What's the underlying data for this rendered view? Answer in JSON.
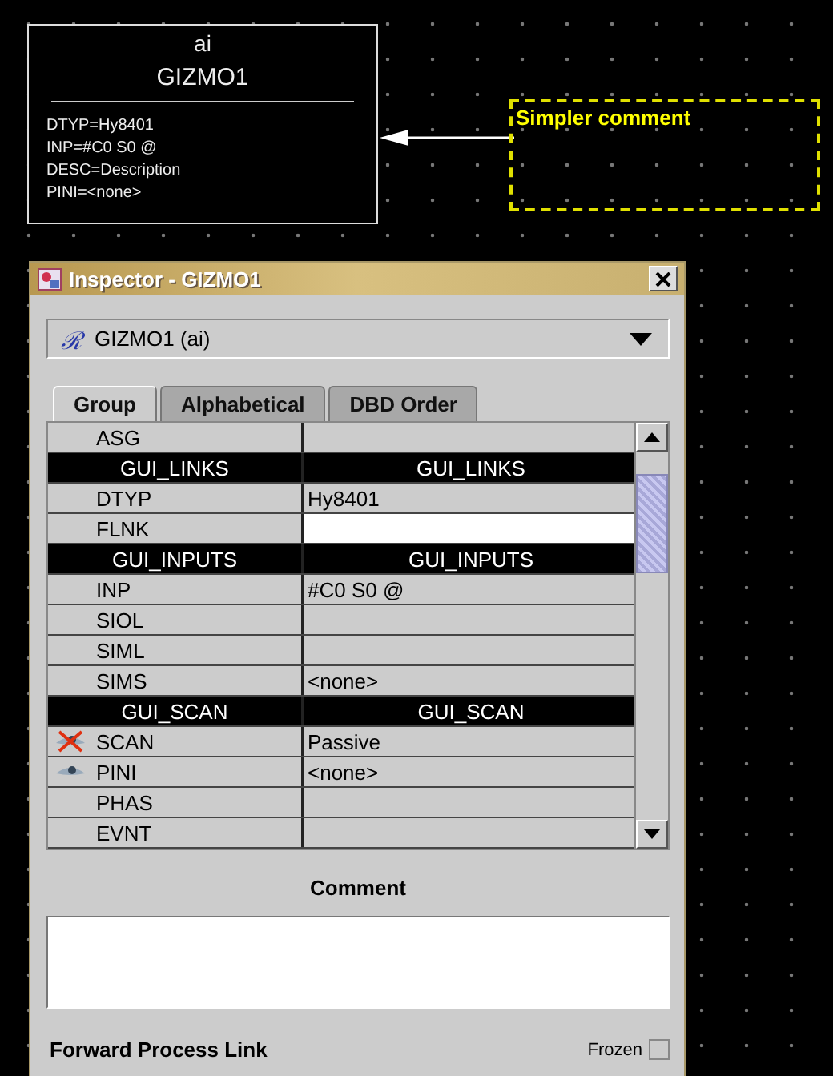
{
  "record": {
    "type": "ai",
    "name": "GIZMO1",
    "fields": [
      "DTYP=Hy8401",
      "INP=#C0 S0 @",
      "DESC=Description",
      "PINI=<none>"
    ]
  },
  "comment_node": {
    "text": "Simpler comment"
  },
  "inspector": {
    "title": "Inspector - GIZMO1",
    "record_select": {
      "icon": "ℛ",
      "value": "GIZMO1 (ai)"
    },
    "tabs": [
      {
        "label": "Group",
        "selected": true
      },
      {
        "label": "Alphabetical",
        "selected": false
      },
      {
        "label": "DBD Order",
        "selected": false
      }
    ],
    "rows": [
      {
        "kind": "field",
        "name": "ASG",
        "selected": false,
        "eye": false,
        "crossed": false
      },
      {
        "kind": "group",
        "name": "GUI_LINKS",
        "value": "GUI_LINKS"
      },
      {
        "kind": "field",
        "name": "DTYP",
        "value": "Hy8401",
        "selected": false,
        "eye": false,
        "crossed": false
      },
      {
        "kind": "field",
        "name": "FLNK",
        "selected": true,
        "eye": false,
        "crossed": false
      },
      {
        "kind": "group",
        "name": "GUI_INPUTS",
        "value": "GUI_INPUTS"
      },
      {
        "kind": "field",
        "name": "INP",
        "value": "#C0 S0 @",
        "selected": false,
        "eye": false,
        "crossed": false
      },
      {
        "kind": "field",
        "name": "SIOL",
        "selected": false,
        "eye": false,
        "crossed": false
      },
      {
        "kind": "field",
        "name": "SIML",
        "selected": false,
        "eye": false,
        "crossed": false
      },
      {
        "kind": "field",
        "name": "SIMS",
        "value": "<none>",
        "selected": false,
        "eye": false,
        "crossed": false
      },
      {
        "kind": "group",
        "name": "GUI_SCAN",
        "value": "GUI_SCAN"
      },
      {
        "kind": "field",
        "name": "SCAN",
        "value": "Passive",
        "selected": false,
        "eye": true,
        "crossed": true
      },
      {
        "kind": "field",
        "name": "PINI",
        "value": "<none>",
        "selected": false,
        "eye": true,
        "crossed": false
      },
      {
        "kind": "field",
        "name": "PHAS",
        "selected": false,
        "eye": false,
        "crossed": false
      },
      {
        "kind": "field",
        "name": "EVNT",
        "selected": false,
        "eye": false,
        "crossed": false
      }
    ],
    "comment_label": "Comment",
    "footer": {
      "label": "Forward Process Link",
      "frozen_label": "Frozen",
      "frozen": false
    }
  }
}
